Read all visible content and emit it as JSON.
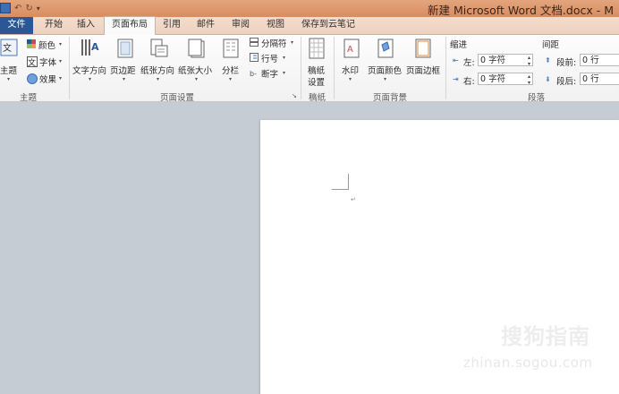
{
  "window": {
    "title": "新建 Microsoft Word 文档.docx - M"
  },
  "tabs": [
    {
      "label": "文件"
    },
    {
      "label": "开始"
    },
    {
      "label": "插入"
    },
    {
      "label": "页面布局"
    },
    {
      "label": "引用"
    },
    {
      "label": "邮件"
    },
    {
      "label": "审阅"
    },
    {
      "label": "视图"
    },
    {
      "label": "保存到云笔记"
    }
  ],
  "ribbon": {
    "theme": {
      "themes_label": "主题",
      "colors_label": "颜色",
      "fonts_label": "字体",
      "effects_label": "效果",
      "group_label": "主题"
    },
    "page_setup": {
      "text_direction": "文字方向",
      "margins": "页边距",
      "orientation": "纸张方向",
      "size": "纸张大小",
      "columns": "分栏",
      "breaks": "分隔符",
      "line_numbers": "行号",
      "hyphenation": "断字",
      "group_label": "页面设置"
    },
    "manuscript": {
      "button": "稿纸\n设置",
      "line1": "稿纸",
      "line2": "设置",
      "group_label": "稿纸"
    },
    "page_background": {
      "watermark": "水印",
      "page_color": "页面颜色",
      "page_borders": "页面边框",
      "group_label": "页面背景"
    },
    "paragraph": {
      "indent_header": "缩进",
      "spacing_header": "间距",
      "indent_left_label": "左:",
      "indent_left_value": "0 字符",
      "indent_right_label": "右:",
      "indent_right_value": "0 字符",
      "spacing_before_label": "段前:",
      "spacing_before_value": "0 行",
      "spacing_after_label": "段后:",
      "spacing_after_value": "0 行",
      "group_label": "段落"
    }
  },
  "watermark": {
    "brand": "搜狗指南",
    "url": "zhinan.sogou.com"
  }
}
